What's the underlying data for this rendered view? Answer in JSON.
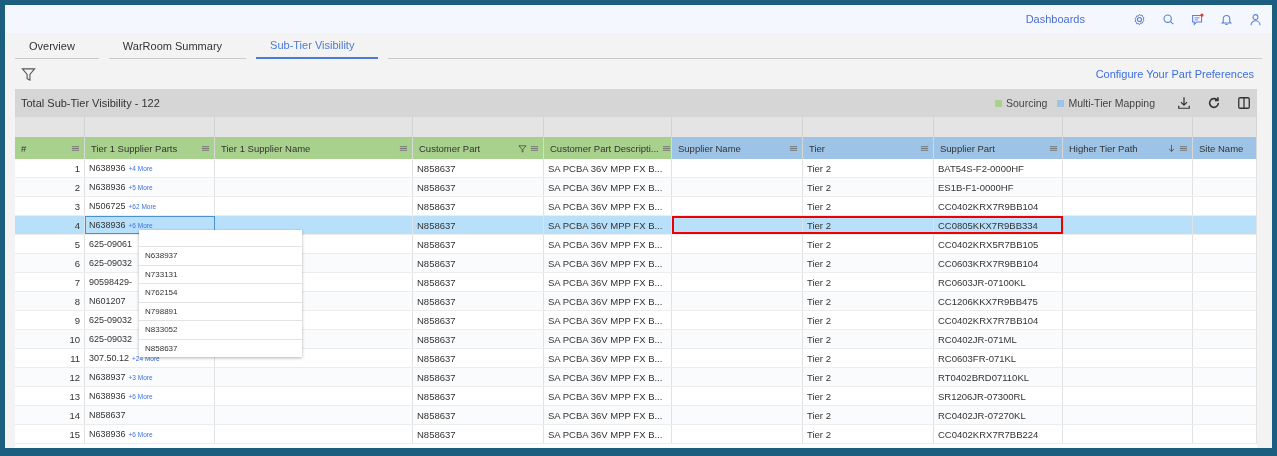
{
  "topbar": {
    "link": "Dashboards",
    "notification": true
  },
  "tabs": [
    {
      "label": "Overview",
      "selected": false
    },
    {
      "label": "WarRoom Summary",
      "selected": false
    },
    {
      "label": "Sub-Tier Visibility",
      "selected": true
    }
  ],
  "preferences_link": "Configure Your Part Preferences",
  "title": "Total Sub-Tier Visibility - 122",
  "legend": [
    {
      "kind": "sourcing",
      "label": "Sourcing",
      "color": "#a9d18e"
    },
    {
      "kind": "mapping",
      "label": "Multi-Tier Mapping",
      "color": "#9dc3e6"
    }
  ],
  "columns": [
    {
      "label": "#",
      "kind": "sourcing",
      "menu": true,
      "filtered": false,
      "sorted_descending": false
    },
    {
      "label": "Tier 1 Supplier Parts",
      "kind": "sourcing",
      "menu": true,
      "filtered": false,
      "sorted_descending": false
    },
    {
      "label": "Tier 1 Supplier Name",
      "kind": "sourcing",
      "menu": true,
      "filtered": false,
      "sorted_descending": false
    },
    {
      "label": "Customer Part",
      "kind": "sourcing",
      "menu": true,
      "filtered": true,
      "sorted_descending": false
    },
    {
      "label": "Customer Part Descripti...",
      "kind": "sourcing",
      "menu": true,
      "filtered": false,
      "sorted_descending": false
    },
    {
      "label": "Supplier Name",
      "kind": "mapping",
      "menu": true,
      "filtered": false,
      "sorted_descending": false
    },
    {
      "label": "Tier",
      "kind": "mapping",
      "menu": true,
      "filtered": false,
      "sorted_descending": false
    },
    {
      "label": "Supplier Part",
      "kind": "mapping",
      "menu": true,
      "filtered": false,
      "sorted_descending": false
    },
    {
      "label": "Higher Tier Path",
      "kind": "mapping",
      "menu": true,
      "filtered": false,
      "sorted_descending": true
    },
    {
      "label": "Site Name",
      "kind": "mapping",
      "menu": false,
      "filtered": false,
      "sorted_descending": false
    }
  ],
  "rows": [
    {
      "num": "1",
      "part": "N638936",
      "more": "+4 More",
      "customer_part": "N858637",
      "description": "SA PCBA 36V MPP FX B...",
      "tier": "Tier 2",
      "supplier_part": "BAT54S-F2-0000HF",
      "selected": false
    },
    {
      "num": "2",
      "part": "N638936",
      "more": "+5 More",
      "customer_part": "N858637",
      "description": "SA PCBA 36V MPP FX B...",
      "tier": "Tier 2",
      "supplier_part": "ES1B-F1-0000HF",
      "selected": false
    },
    {
      "num": "3",
      "part": "N506725",
      "more": "+62 More",
      "customer_part": "N858637",
      "description": "SA PCBA 36V MPP FX B...",
      "tier": "Tier 2",
      "supplier_part": "CC0402KRX7R9BB104",
      "selected": false
    },
    {
      "num": "4",
      "part": "N638936",
      "more": "+6 More",
      "customer_part": "N858637",
      "description": "SA PCBA 36V MPP FX B...",
      "tier": "Tier 2",
      "supplier_part": "CC0805KKX7R9BB334",
      "selected": true,
      "focused": true,
      "flagged": true
    },
    {
      "num": "5",
      "part": "625-09061",
      "customer_part": "N858637",
      "description": "SA PCBA 36V MPP FX B...",
      "tier": "Tier 2",
      "supplier_part": "CC0402KRX5R7BB105",
      "selected": false
    },
    {
      "num": "6",
      "part": "625-09032",
      "customer_part": "N858637",
      "description": "SA PCBA 36V MPP FX B...",
      "tier": "Tier 2",
      "supplier_part": "CC0603KRX7R9BB104",
      "selected": false
    },
    {
      "num": "7",
      "part": "90598429-",
      "customer_part": "N858637",
      "description": "SA PCBA 36V MPP FX B...",
      "tier": "Tier 2",
      "supplier_part": "RC0603JR-07100KL",
      "selected": false
    },
    {
      "num": "8",
      "part": "N601207",
      "customer_part": "N858637",
      "description": "SA PCBA 36V MPP FX B...",
      "tier": "Tier 2",
      "supplier_part": "CC1206KKX7R9BB475",
      "selected": false
    },
    {
      "num": "9",
      "part": "625-09032",
      "customer_part": "N858637",
      "description": "SA PCBA 36V MPP FX B...",
      "tier": "Tier 2",
      "supplier_part": "CC0402KRX7R7BB104",
      "selected": false
    },
    {
      "num": "10",
      "part": "625-09032",
      "customer_part": "N858637",
      "description": "SA PCBA 36V MPP FX B...",
      "tier": "Tier 2",
      "supplier_part": "RC0402JR-071ML",
      "selected": false
    },
    {
      "num": "11",
      "part": "307.50.12",
      "more": "+24 More",
      "customer_part": "N858637",
      "description": "SA PCBA 36V MPP FX B...",
      "tier": "Tier 2",
      "supplier_part": "RC0603FR-071KL",
      "selected": false
    },
    {
      "num": "12",
      "part": "N638937",
      "more": "+3 More",
      "customer_part": "N858637",
      "description": "SA PCBA 36V MPP FX B...",
      "tier": "Tier 2",
      "supplier_part": "RT0402BRD07110KL",
      "selected": false
    },
    {
      "num": "13",
      "part": "N638936",
      "more": "+6 More",
      "customer_part": "N858637",
      "description": "SA PCBA 36V MPP FX B...",
      "tier": "Tier 2",
      "supplier_part": "SR1206JR-07300RL",
      "selected": false
    },
    {
      "num": "14",
      "part": "N858637",
      "customer_part": "N858637",
      "description": "SA PCBA 36V MPP FX B...",
      "tier": "Tier 2",
      "supplier_part": "RC0402JR-07270KL",
      "selected": false
    },
    {
      "num": "15",
      "part": "N638936",
      "more": "+6 More",
      "customer_part": "N858637",
      "description": "SA PCBA 36V MPP FX B...",
      "tier": "Tier 2",
      "supplier_part": "CC0402KRX7R7BB224",
      "selected": false
    }
  ],
  "popup": [
    "N638937",
    "N733131",
    "N762154",
    "N798891",
    "N833052",
    "N858637"
  ]
}
